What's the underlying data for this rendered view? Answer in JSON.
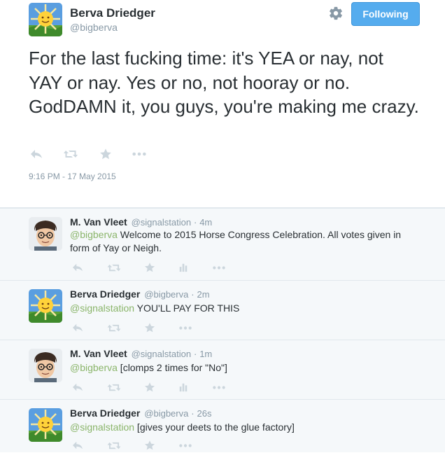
{
  "main_tweet": {
    "name": "Berva Driedger",
    "handle": "@bigberva",
    "follow_label": "Following",
    "text": "For the last fucking time: it's YEA or nay, not YAY or nay. Yes or no, not hooray or no. GodDAMN it, you guys, you're making me crazy.",
    "timestamp": "9:16 PM - 17 May 2015"
  },
  "replies": [
    {
      "name": "M. Van Vleet",
      "handle": "@signalstation",
      "sep": "·",
      "time": "4m",
      "mention": "@bigberva",
      "text": " Welcome to 2015 Horse Congress Celebration. All votes given in form of Yay or Neigh."
    },
    {
      "name": "Berva Driedger",
      "handle": "@bigberva",
      "sep": "·",
      "time": "2m",
      "mention": "@signalstation",
      "text": " YOU'LL PAY FOR THIS"
    },
    {
      "name": "M. Van Vleet",
      "handle": "@signalstation",
      "sep": "·",
      "time": "1m",
      "mention": "@bigberva",
      "text": " [clomps 2 times for \"No\"]"
    },
    {
      "name": "Berva Driedger",
      "handle": "@bigberva",
      "sep": "·",
      "time": "26s",
      "mention": "@signalstation",
      "text": " [gives your deets to the glue factory]"
    }
  ],
  "icons": {
    "reply": "reply-icon",
    "retweet": "retweet-icon",
    "favorite": "star-icon",
    "analytics": "analytics-icon",
    "more": "more-icon",
    "settings": "gear-icon"
  },
  "colors": {
    "follow_button": "#55acee",
    "mention": "#8ab56a",
    "icon": "#ccd6dd",
    "replies_background": "#f5f8fa"
  }
}
